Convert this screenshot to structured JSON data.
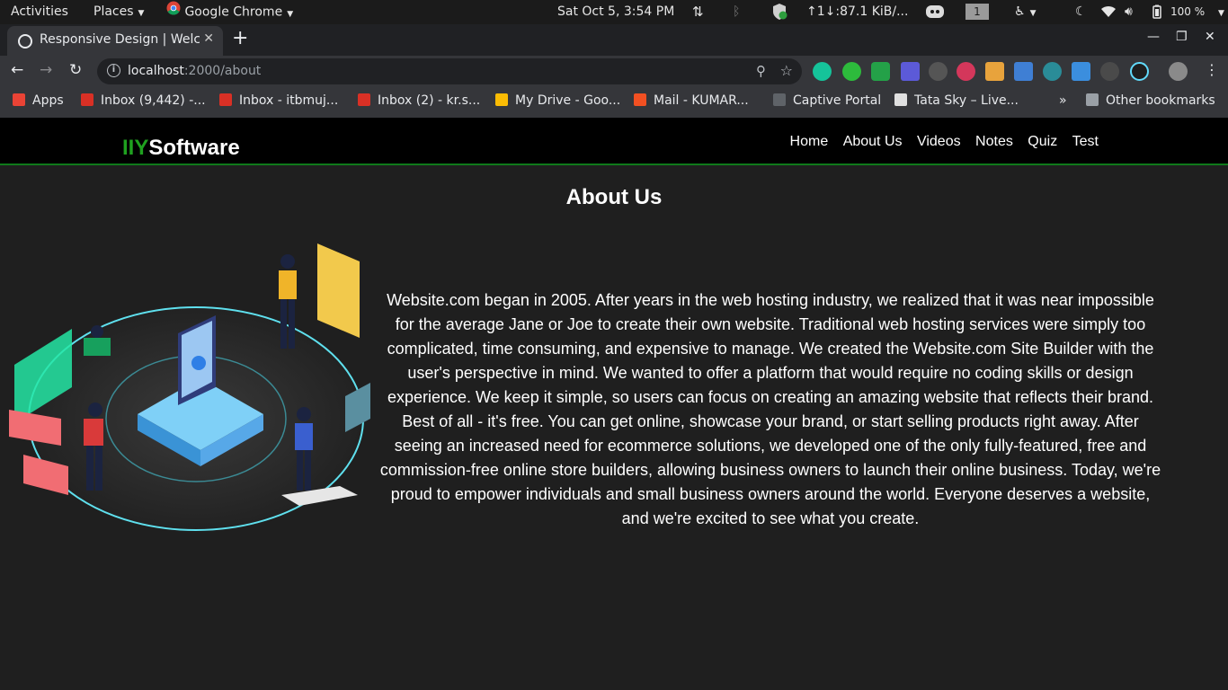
{
  "system_bar": {
    "activities": "Activities",
    "places": "Places",
    "app": "Google Chrome",
    "clock": "Sat Oct  5,  3:54 PM",
    "net_speed": "↑1↓:87.1 KiB/...",
    "workspace": "1",
    "battery": "100 %"
  },
  "tab": {
    "title": "Responsive Design | Welcome"
  },
  "omnibox": {
    "host": "localhost",
    "path": ":2000/about"
  },
  "bookmarks": {
    "items": [
      {
        "label": "Apps",
        "color": "#ea4335"
      },
      {
        "label": "Inbox (9,442) -...",
        "color": "#d93025"
      },
      {
        "label": "Inbox - itbmuj...",
        "color": "#d93025"
      },
      {
        "label": "Inbox (2) - kr.s...",
        "color": "#d93025"
      },
      {
        "label": "My Drive - Goo...",
        "color": "#fbbc04"
      },
      {
        "label": "Mail - KUMAR...",
        "color": "#f25022"
      },
      {
        "label": "Captive Portal",
        "color": "#5f6368"
      },
      {
        "label": "Tata Sky – Live...",
        "color": "#e0e0e0"
      }
    ],
    "overflow": "»",
    "other": "Other bookmarks"
  },
  "site": {
    "brand_accent": "IIY",
    "brand_rest": "Software",
    "nav": [
      "Home",
      "About Us",
      "Videos",
      "Notes",
      "Quiz",
      "Test"
    ],
    "heading": "About Us",
    "about_text": "Website.com began in 2005. After years in the web hosting industry, we realized that it was near impossible for the average Jane or Joe to create their own website. Traditional web hosting services were simply too complicated, time consuming, and expensive to manage. We created the Website.com Site Builder with the user's perspective in mind. We wanted to offer a platform that would require no coding skills or design experience. We keep it simple, so users can focus on creating an amazing website that reflects their brand. Best of all - it's free. You can get online, showcase your brand, or start selling products right away. After seeing an increased need for ecommerce solutions, we developed one of the only fully-featured, free and commission-free online store builders, allowing business owners to launch their online business. Today, we're proud to empower individuals and small business owners around the world. Everyone deserves a website, and we're excited to see what you create."
  },
  "colors": {
    "brand_accent": "#1fa11f",
    "nav_border": "#0f7a1a",
    "page_bg": "#1f1f1f"
  }
}
